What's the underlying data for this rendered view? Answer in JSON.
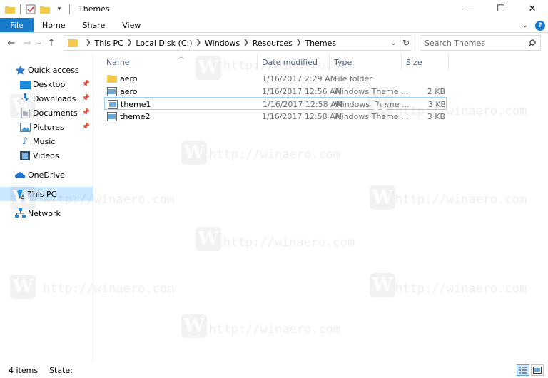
{
  "window": {
    "title": "Themes"
  },
  "ribbon": {
    "tabs": [
      {
        "label": "File"
      },
      {
        "label": "Home"
      },
      {
        "label": "Share"
      },
      {
        "label": "View"
      }
    ],
    "help_label": "?"
  },
  "address": {
    "crumbs": [
      "This PC",
      "Local Disk (C:)",
      "Windows",
      "Resources",
      "Themes"
    ]
  },
  "search": {
    "placeholder": "Search Themes"
  },
  "columns": {
    "name": "Name",
    "date": "Date modified",
    "type": "Type",
    "size": "Size"
  },
  "files": [
    {
      "name": "aero",
      "date": "1/16/2017 2:29 AM",
      "type": "File folder",
      "size": "",
      "icon": "folder-icon"
    },
    {
      "name": "aero",
      "date": "1/16/2017 12:56 AM",
      "type": "Windows Theme ...",
      "size": "2 KB",
      "icon": "theme-file-icon"
    },
    {
      "name": "theme1",
      "date": "1/16/2017 12:58 AM",
      "type": "Windows Theme ...",
      "size": "3 KB",
      "icon": "theme-file-icon"
    },
    {
      "name": "theme2",
      "date": "1/16/2017 12:58 AM",
      "type": "Windows Theme ...",
      "size": "3 KB",
      "icon": "theme-file-icon"
    }
  ],
  "navpane": {
    "items": [
      {
        "label": "Quick access",
        "icon": "star-icon"
      },
      {
        "label": "Desktop",
        "icon": "desktop-icon",
        "pinned": true
      },
      {
        "label": "Downloads",
        "icon": "downloads-icon",
        "pinned": true
      },
      {
        "label": "Documents",
        "icon": "documents-icon",
        "pinned": true
      },
      {
        "label": "Pictures",
        "icon": "pictures-icon",
        "pinned": true
      },
      {
        "label": "Music",
        "icon": "music-icon"
      },
      {
        "label": "Videos",
        "icon": "videos-icon"
      },
      {
        "label": "OneDrive",
        "icon": "onedrive-icon"
      },
      {
        "label": "This PC",
        "icon": "computer-icon"
      },
      {
        "label": "Network",
        "icon": "network-icon"
      }
    ]
  },
  "status": {
    "items_count": "4 items",
    "state_label": "State:"
  },
  "watermark": {
    "text": "http://winaero.com",
    "letter": "W"
  },
  "colors": {
    "accent": "#1979ca",
    "selection": "#cce8ff",
    "selection_border": "#99d1ff"
  }
}
